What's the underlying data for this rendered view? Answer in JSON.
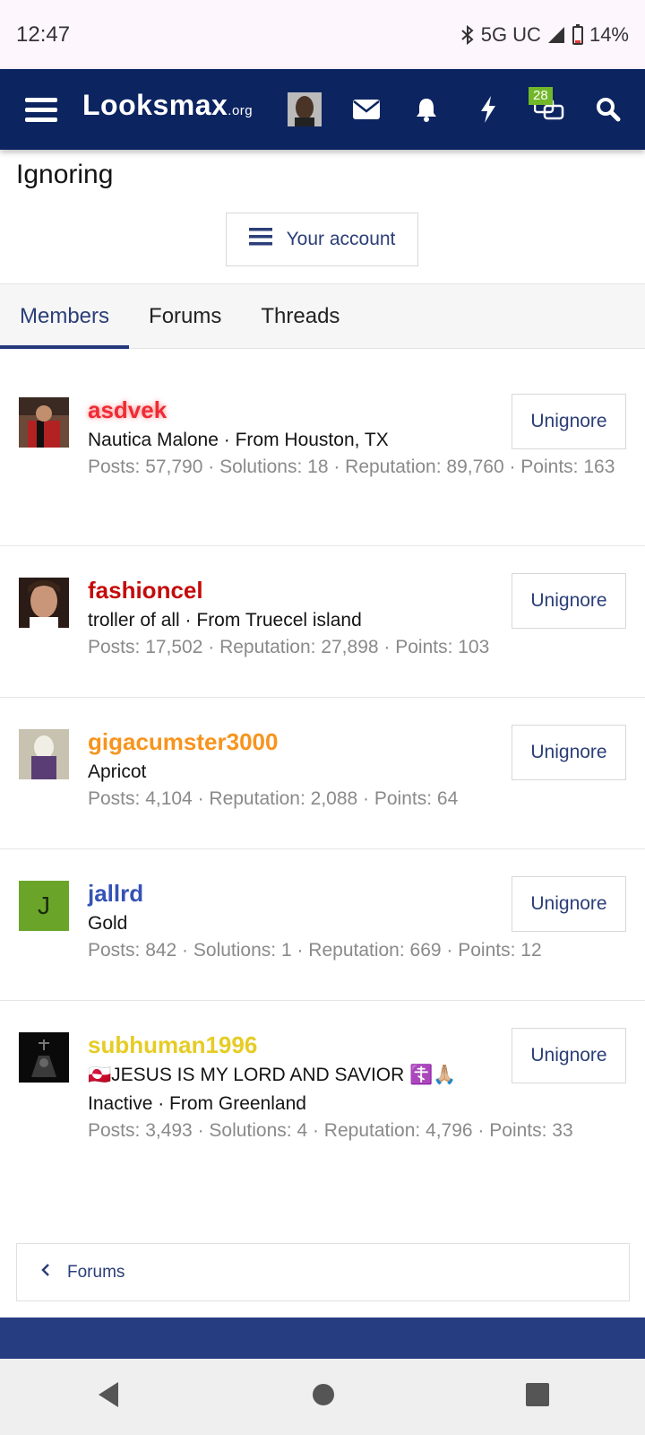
{
  "status": {
    "time": "12:47",
    "network": "5G UC",
    "battery": "14%"
  },
  "nav": {
    "logo_main": "Looksmax",
    "logo_suffix": ".org",
    "conversations_badge": "28"
  },
  "page": {
    "title": "Ignoring",
    "account_button": "Your account"
  },
  "tabs": [
    {
      "label": "Members",
      "active": true
    },
    {
      "label": "Forums",
      "active": false
    },
    {
      "label": "Threads",
      "active": false
    }
  ],
  "members": [
    {
      "username": "asdvek",
      "info": "Nautica Malone · From Houston, TX",
      "stats": "Posts: 57,790 · Solutions: 18 · Reputation: 89,760 · Points: 163",
      "button": "Unignore"
    },
    {
      "username": "fashioncel",
      "info": "troller of all · From Truecel island",
      "stats": "Posts: 17,502 · Reputation: 27,898 · Points: 103",
      "button": "Unignore"
    },
    {
      "username": "gigacumster3000",
      "info": "Apricot",
      "stats": "Posts: 4,104 · Reputation: 2,088 · Points: 64",
      "button": "Unignore"
    },
    {
      "username": "jallrd",
      "avatar_letter": "J",
      "info": "Gold",
      "stats": "Posts: 842 · Solutions: 1 · Reputation: 669 · Points: 12",
      "button": "Unignore"
    },
    {
      "username": "subhuman1996",
      "info": "🇬🇱JESUS IS MY LORD AND SAVIOR ☦️🙏🏼",
      "info2": "Inactive · From Greenland",
      "stats": "Posts: 3,493 · Solutions: 4 · Reputation: 4,796 · Points: 33",
      "button": "Unignore"
    }
  ],
  "breadcrumb": {
    "label": "Forums"
  },
  "colors": {
    "nav_bg": "#0c2460",
    "accent": "#2b3e78",
    "badge": "#72b72a"
  }
}
